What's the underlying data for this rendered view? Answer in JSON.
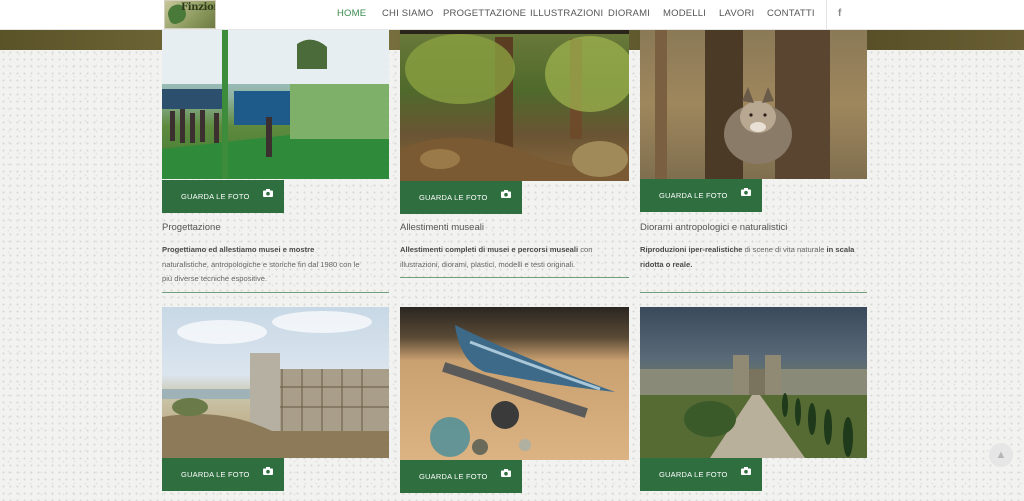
{
  "header": {
    "logo_text": "Finzioni",
    "nav": [
      "HOME",
      "CHI SIAMO",
      "PROGETTAZIONE",
      "ILLUSTRAZIONI",
      "DIORAMI",
      "MODELLI",
      "LAVORI",
      "CONTATTI"
    ],
    "active_index": 0,
    "social_icon": "f"
  },
  "theme": {
    "accent": "#2e6e3f",
    "nav_active": "#3a8a4e"
  },
  "cards_row1": [
    {
      "title": "Progettazione",
      "button": "GUARDA LE FOTO",
      "text_bold": "Progettiamo ed allestiamo musei e mostre",
      "text_rest": " naturalistiche, antropologiche e storiche fin dal 1980 con le più diverse tecniche espositive.",
      "image_desc": "museum-installation-photo"
    },
    {
      "title": "Allestimenti museali",
      "button": "GUARDA LE FOTO",
      "text_bold": "Allestimenti completi di musei e percorsi museali",
      "text_rest": " con illustrazioni, diorami, plastici, modelli e testi originali.",
      "image_desc": "forest-diorama-photo"
    },
    {
      "title": "Diorami antropologici e naturalistici",
      "button": "GUARDA LE FOTO",
      "text_bold": "Riproduzioni iper-realistiche",
      "text_mid": " di scene di vita naturale ",
      "text_bold2": "in scala ridotta o reale.",
      "image_desc": "wolf-diorama-photo"
    }
  ],
  "cards_row2": [
    {
      "button": "GUARDA LE FOTO",
      "image_desc": "castle-illustration"
    },
    {
      "button": "GUARDA LE FOTO",
      "image_desc": "fish-model-photo"
    },
    {
      "button": "GUARDA LE FOTO",
      "image_desc": "castle-render"
    }
  ],
  "scroll_icon": "arrow-up"
}
